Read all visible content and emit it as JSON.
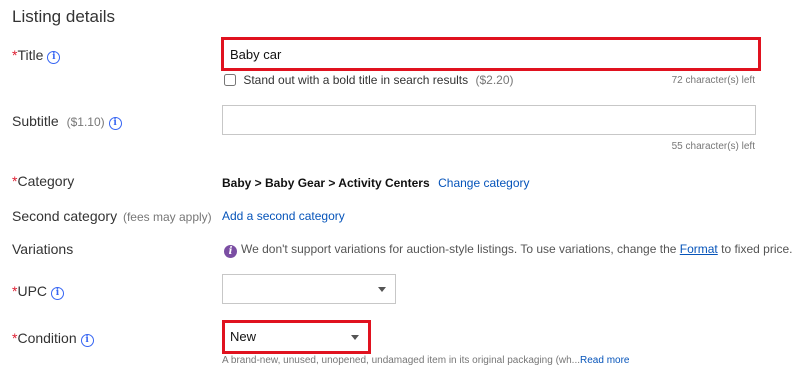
{
  "heading": "Listing details",
  "title": {
    "required_mark": "*",
    "label": "Title",
    "value": "Baby car",
    "bold_option_label": "Stand out with a bold title in search results",
    "bold_option_price": "($2.20)",
    "chars_left": "72 character(s) left"
  },
  "subtitle": {
    "label": "Subtitle",
    "price": "($1.10)",
    "value": "",
    "chars_left": "55 character(s) left"
  },
  "category": {
    "required_mark": "*",
    "label": "Category",
    "path": "Baby > Baby Gear > Activity Centers",
    "change_link": "Change category"
  },
  "second_category": {
    "label": "Second category",
    "note": "(fees may apply)",
    "add_link": "Add a second category"
  },
  "variations": {
    "label": "Variations",
    "message_prefix": "We don't support variations for auction-style listings. To use variations, change the",
    "format_link": "Format",
    "message_suffix": "to fixed price."
  },
  "upc": {
    "required_mark": "*",
    "label": "UPC",
    "value": ""
  },
  "condition": {
    "required_mark": "*",
    "label": "Condition",
    "value": "New",
    "description": "A brand-new, unused, unopened, undamaged item in its original packaging (wh...",
    "read_more": "Read more"
  },
  "colors": {
    "required": "#dd1e31",
    "link": "#0654ba",
    "highlight": "#e0121f",
    "info_icon": "#3665f3"
  },
  "icons": {
    "info": "info-circle-icon",
    "variations_info": "info-filled-icon",
    "dropdown": "chevron-down-icon"
  }
}
